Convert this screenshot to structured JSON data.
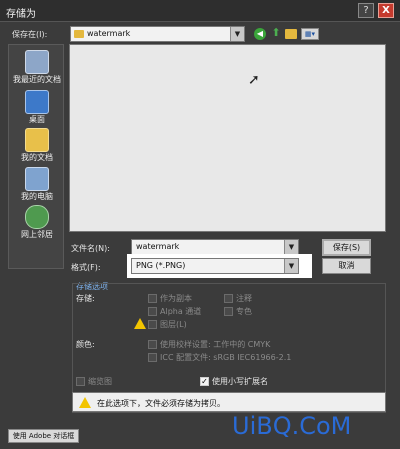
{
  "window": {
    "title": "存储为",
    "help_label": "?",
    "close_label": "X"
  },
  "location": {
    "label": "保存在(I):",
    "value": "watermark",
    "icons": [
      "folder-icon",
      "back-icon",
      "up-folder-icon",
      "new-folder-icon",
      "view-menu-icon"
    ]
  },
  "sidebar": {
    "items": [
      {
        "label": "我最近的文档",
        "icon": "recent-documents-icon"
      },
      {
        "label": "桌面",
        "icon": "desktop-icon"
      },
      {
        "label": "我的文档",
        "icon": "my-documents-icon"
      },
      {
        "label": "我的电脑",
        "icon": "my-computer-icon"
      },
      {
        "label": "网上邻居",
        "icon": "network-places-icon"
      }
    ]
  },
  "filename": {
    "label": "文件名(N):",
    "value": "watermark"
  },
  "format": {
    "label": "格式(F):",
    "value": "PNG (*.PNG)"
  },
  "buttons": {
    "save": "保存(S)",
    "cancel": "取消"
  },
  "options": {
    "group_title": "存储选项",
    "storage_label": "存储:",
    "as_copy": "作为副本",
    "annotations": "注释",
    "alpha": "Alpha 通道",
    "spot": "专色",
    "layers": "图层(L)",
    "color_label": "颜色:",
    "use_proof": "使用校样设置: 工作中的 CMYK",
    "icc": "ICC 配置文件: sRGB IEC61966-2.1",
    "thumbnail": "缩览图",
    "lowercase_ext": "使用小写扩展名"
  },
  "warning": {
    "text": "在此选项下，文件必须存储为拷贝。"
  },
  "footer": {
    "adobe_dialog_button": "使用 Adobe 对话框"
  },
  "watermark": {
    "text": "UiBQ.CoM"
  },
  "colors": {
    "warning": "#f2c400",
    "watermark": "#2a6bd6",
    "close": "#c63b2e"
  }
}
